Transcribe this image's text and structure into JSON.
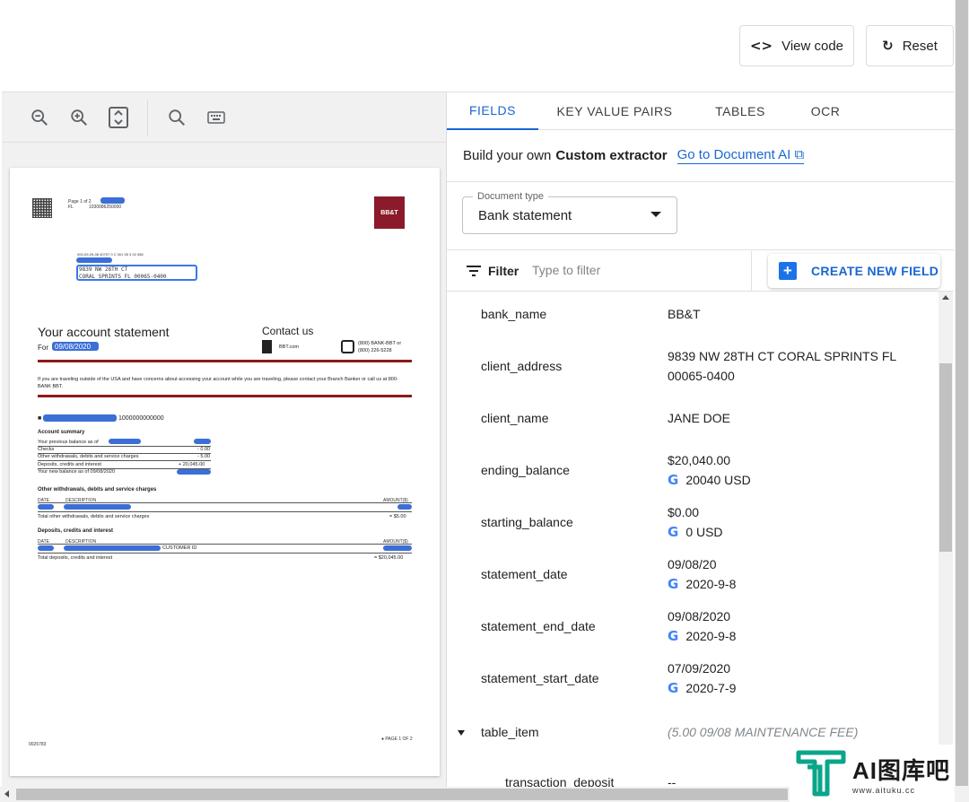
{
  "toolbar": {
    "view_code": "View code",
    "reset": "Reset"
  },
  "viewer": {
    "tools": [
      "zoom-out-icon",
      "zoom-in-icon",
      "fit-page-icon",
      "search-icon",
      "keyboard-icon"
    ],
    "doc": {
      "page_label": "Page 1 of 2",
      "fl": "FL",
      "fl_num": "1030086250000",
      "address_line1": "9839 NW 28TH CT",
      "address_line2": "CORAL SPRINTS FL 00065-0400",
      "heading": "Your account statement",
      "for_label": "For",
      "for_date": "09/08/2020",
      "contact": "Contact us",
      "bbt_site": "BBT.com",
      "phone1": "(800) BANK-BBT or",
      "phone2": "(800) 226-5228",
      "notice": "If you are traveling outside of the USA and have concerns about accessing your account while you are traveling, please contact your Branch Banker or call us at 800-BANK BBT.",
      "account_no": "1000000000000",
      "account_summary": "Account summary",
      "summary_rows": [
        {
          "label": "Your previous balance as of",
          "amount": ""
        },
        {
          "label": "Checks",
          "amount": "- 0.00"
        },
        {
          "label": "Other withdrawals, debits and service charges",
          "amount": "- 5.00"
        },
        {
          "label": "Deposits, credits and interest",
          "amount": "+ 20,045.00"
        },
        {
          "label": "Your new balance as of 09/08/2020",
          "amount": ""
        }
      ],
      "other_withdrawals": "Other withdrawals, debits and service charges",
      "col_date": "DATE",
      "col_desc": "DESCRIPTION",
      "col_amount": "AMOUNT($)",
      "total_withdrawals": "Total other withdrawals, debits and service charges",
      "total_withdrawals_amt": "= $5.00",
      "deposits_title": "Deposits, credits and interest",
      "customer_id": "CUSTOMER ID",
      "total_deposits": "Total deposits, credits and interest",
      "total_deposits_amt": "= $20,045.00",
      "page_footer": "● PAGE 1 OF 2",
      "footer_code": "0026783"
    }
  },
  "tabs": [
    "FIELDS",
    "KEY VALUE PAIRS",
    "TABLES",
    "OCR"
  ],
  "custom": {
    "prefix": "Build your own",
    "bold": "Custom extractor",
    "link": "Go to Document AI"
  },
  "doctype": {
    "legend": "Document type",
    "value": "Bank statement"
  },
  "filter": {
    "label": "Filter",
    "placeholder": "Type to filter",
    "create": "CREATE NEW FIELD"
  },
  "fields": [
    {
      "name": "bank_name",
      "value": "BB&T"
    },
    {
      "name": "client_address",
      "value": "9839 NW 28TH CT CORAL SPRINTS FL",
      "value2": "00065-0400"
    },
    {
      "name": "client_name",
      "value": "JANE DOE"
    },
    {
      "name": "ending_balance",
      "value": "$20,040.00",
      "normalized": "20040 USD"
    },
    {
      "name": "starting_balance",
      "value": "$0.00",
      "normalized": "0 USD"
    },
    {
      "name": "statement_date",
      "value": "09/08/20",
      "normalized": "2020-9-8"
    },
    {
      "name": "statement_end_date",
      "value": "09/08/2020",
      "normalized": "2020-9-8"
    },
    {
      "name": "statement_start_date",
      "value": "07/09/2020",
      "normalized": "2020-7-9"
    },
    {
      "name": "table_item",
      "value": "(5.00 09/08 MAINTENANCE FEE)"
    },
    {
      "name": "transaction_deposit",
      "value": "--"
    }
  ],
  "watermark": {
    "title": "AI图库吧",
    "url": "www.aituku.cc"
  },
  "colors": {
    "accent": "#1967d2",
    "brand_red": "#8b1a2b"
  }
}
